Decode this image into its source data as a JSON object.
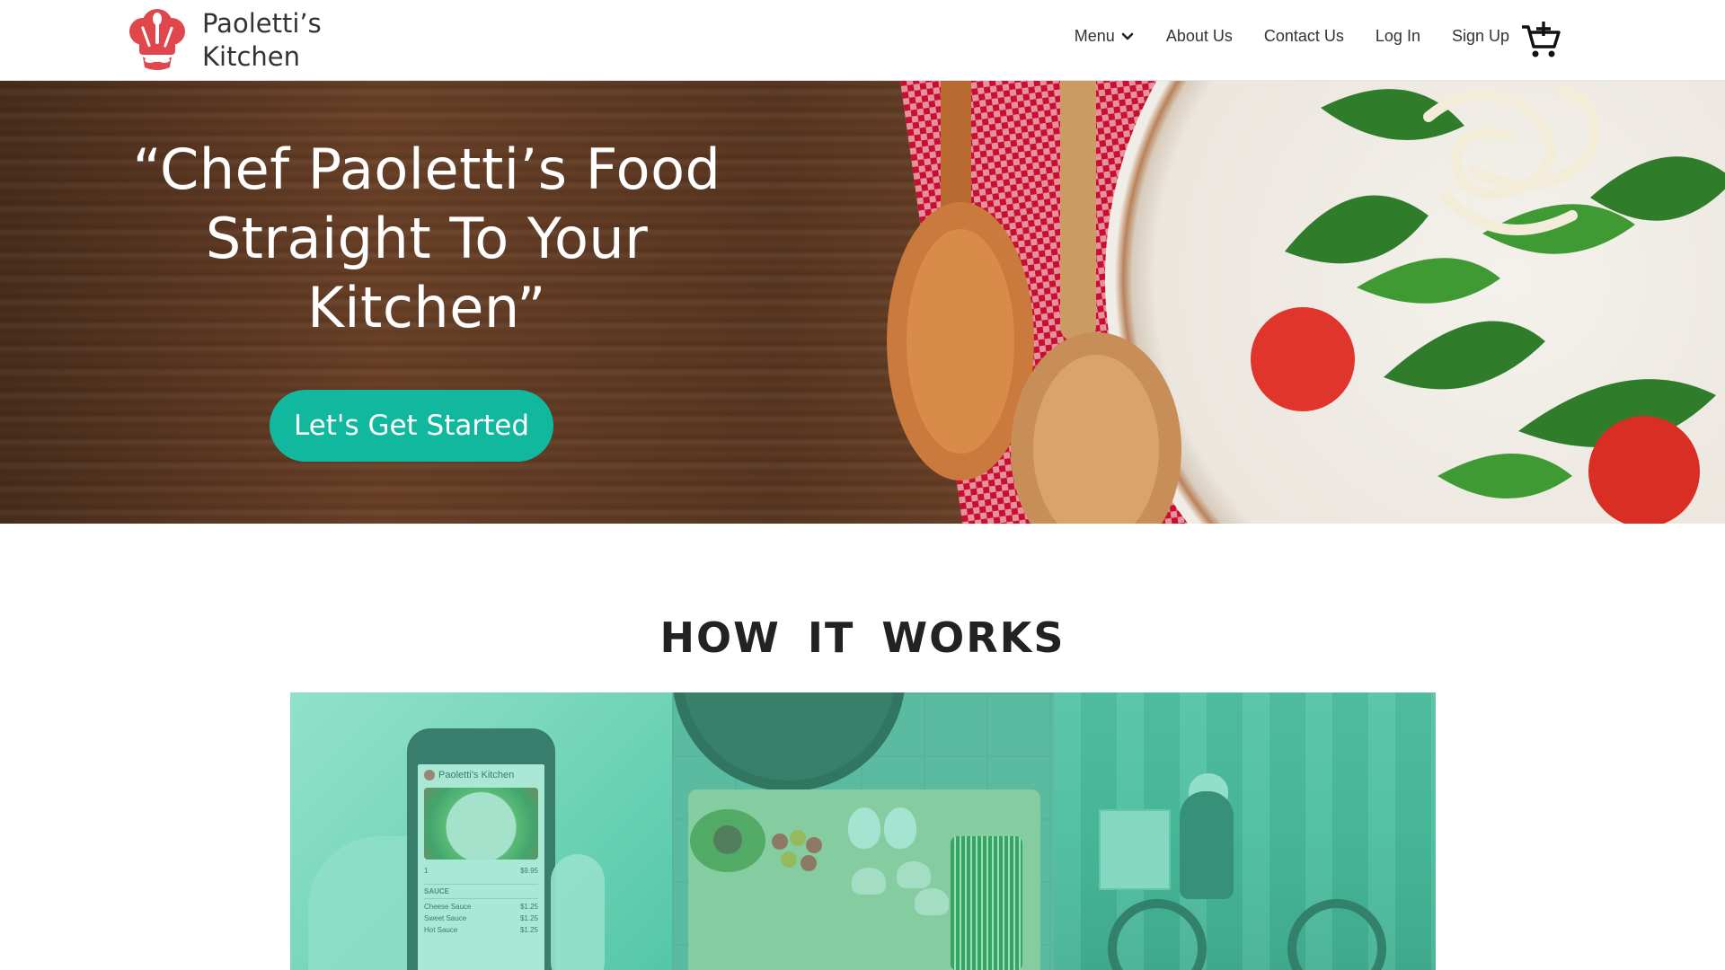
{
  "brand": {
    "name_line1": "Paoletti’s",
    "name_line2": "Kitchen",
    "logo_icon": "chef-hat-logo",
    "accent": "#e0474c"
  },
  "nav": {
    "items": [
      {
        "label": "Menu",
        "has_dropdown": true
      },
      {
        "label": "About Us"
      },
      {
        "label": "Contact Us"
      },
      {
        "label": "Log In"
      },
      {
        "label": "Sign Up"
      }
    ],
    "cart_icon": "add-to-cart-icon"
  },
  "hero": {
    "quote": "“Chef Paoletti’s Food Straight To Your Kitchen”",
    "cta_label": "Let's Get Started",
    "cta_color": "#12b89e"
  },
  "how_it_works": {
    "title": "HOW IT WORKS",
    "tint_color": "#46d2aa",
    "phone_app": {
      "title": "Paoletti’s Kitchen",
      "quantity": "1",
      "price": "$9.95",
      "section": "SAUCE",
      "options": [
        {
          "name": "Cheese Sauce",
          "price": "$1.25"
        },
        {
          "name": "Sweet Sauce",
          "price": "$1.25"
        },
        {
          "name": "Hot Sauce",
          "price": "$1.25"
        }
      ]
    }
  }
}
